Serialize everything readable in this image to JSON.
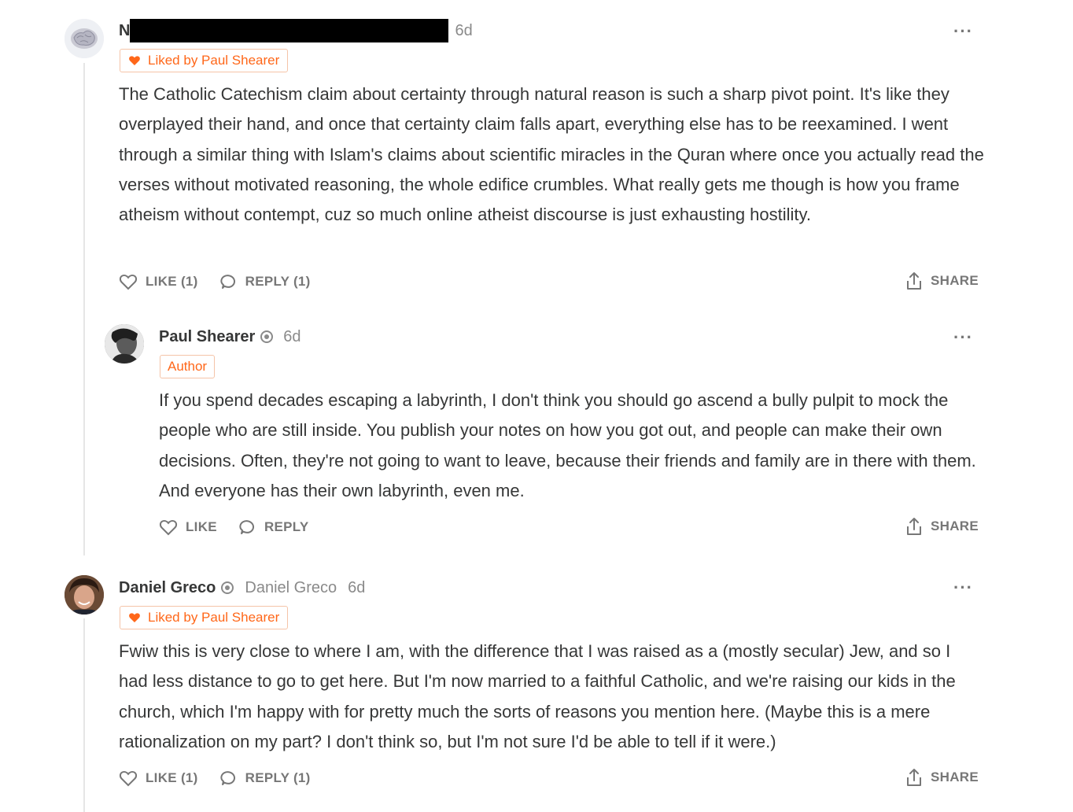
{
  "comments": [
    {
      "author": "N",
      "author_redacted": true,
      "time": "6d",
      "liked_by": "Liked by Paul Shearer",
      "body": "The Catholic Catechism claim about certainty through natural reason is such a sharp pivot point. It's like they overplayed their hand, and once that certainty claim falls apart, everything else has to be reexamined. I went through a similar thing with Islam's claims about scientific miracles in the Quran where once you actually read the verses without motivated reasoning, the whole edifice crumbles. What really gets me though is how you frame atheism without contempt, cuz so much online atheist discourse is just exhausting hostility.",
      "like_label": "LIKE (1)",
      "reply_label": "REPLY (1)",
      "share_label": "SHARE",
      "more_label": "···"
    },
    {
      "author": "Paul Shearer",
      "time": "6d",
      "tag": "Author",
      "body": "If you spend decades escaping a labyrinth, I don't think you should go ascend a bully pulpit to mock the people who are still inside. You publish your notes on how you got out, and people can make their own decisions. Often, they're not going to want to leave, because their friends and family are in there with them. And everyone has their own labyrinth, even me.",
      "like_label": "LIKE",
      "reply_label": "REPLY",
      "share_label": "SHARE",
      "more_label": "···"
    },
    {
      "author": "Daniel Greco",
      "handle": "Daniel Greco",
      "time": "6d",
      "liked_by": "Liked by Paul Shearer",
      "body": "Fwiw this is very close to where I am, with the difference that I was raised as a (mostly secular) Jew, and so I had less distance to go to get here. But I'm now married to a faithful Catholic, and we're raising our kids in the church, which I'm happy with for pretty much the sorts of reasons you mention here. (Maybe this is a mere rationalization on my part? I don't think so, but I'm not sure I'd be able to tell if it were.)",
      "like_label": "LIKE (1)",
      "reply_label": "REPLY (1)",
      "share_label": "SHARE",
      "more_label": "···"
    }
  ],
  "colors": {
    "accent": "#ff6719",
    "text": "#363737",
    "muted": "#777777"
  }
}
